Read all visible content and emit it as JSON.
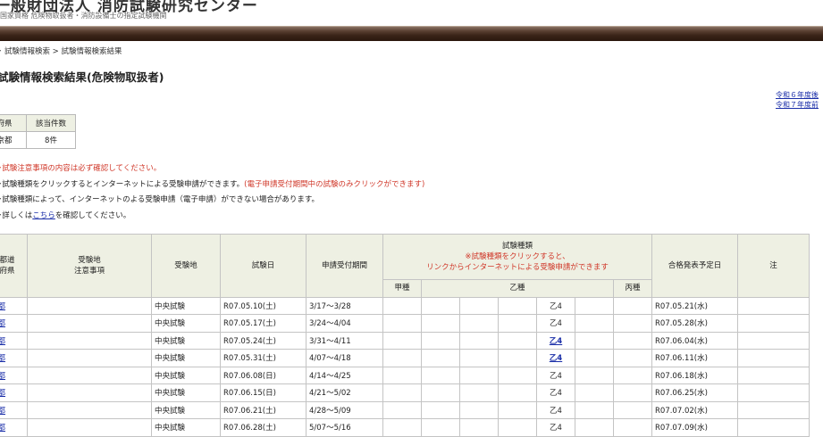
{
  "header": {
    "org_name": "一般財団法人 消防試験研究センター",
    "org_sub": "国家資格 危険物取扱者・消防設備士の指定試験機関"
  },
  "breadcrumb": [
    "試験情報検索",
    "試験情報検索結果"
  ],
  "page_title": "試験情報検索結果(危険物取扱者)",
  "year_links": [
    "令和６年度後",
    "令和７年度前"
  ],
  "summary": {
    "headers": [
      "府県",
      "該当件数"
    ],
    "values": [
      "京都",
      "8件"
    ]
  },
  "notes": {
    "line1": "試験注意事項の内容は必ず確認してください。",
    "line2_prefix": "試験種類をクリックするとインターネットによる受験申請ができます。",
    "line2_red": "(電子申請受付期間中の試験のみクリックができます)",
    "line3": "試験種類によって、インターネットのよる受験申請（電子申請）ができない場合があります。",
    "line4_prefix": "詳しくは",
    "line4_link": "こちら",
    "line4_suffix": "を確認してください。"
  },
  "table": {
    "headers": {
      "pref_line1": "都道",
      "pref_line2": "府県",
      "venue_notes_line1": "受験地",
      "venue_notes_line2": "注意事項",
      "venue": "受験地",
      "exam_date": "試験日",
      "application_period": "申請受付期間",
      "type": "試験種類",
      "type_note_line1": "※試験種類をクリックすると、",
      "type_note_line2": "リンクからインターネットによる受験申請ができます",
      "result_date": "合格発表予定日",
      "last_col": "注",
      "kou": "甲種",
      "otsu": "乙種",
      "hei": "丙種"
    },
    "rows": [
      {
        "pref": "京都",
        "venue": "中央試験",
        "exam_date": "R07.05.10(土)",
        "period": "3/17～3/28",
        "otsu": "乙4",
        "otsu_link": false,
        "result": "R07.05.21(水)"
      },
      {
        "pref": "京都",
        "venue": "中央試験",
        "exam_date": "R07.05.17(土)",
        "period": "3/24～4/04",
        "otsu": "乙4",
        "otsu_link": false,
        "result": "R07.05.28(水)"
      },
      {
        "pref": "京都",
        "venue": "中央試験",
        "exam_date": "R07.05.24(土)",
        "period": "3/31～4/11",
        "otsu": "乙4",
        "otsu_link": true,
        "result": "R07.06.04(水)"
      },
      {
        "pref": "京都",
        "venue": "中央試験",
        "exam_date": "R07.05.31(土)",
        "period": "4/07～4/18",
        "otsu": "乙4",
        "otsu_link": true,
        "result": "R07.06.11(水)"
      },
      {
        "pref": "京都",
        "venue": "中央試験",
        "exam_date": "R07.06.08(日)",
        "period": "4/14～4/25",
        "otsu": "乙4",
        "otsu_link": false,
        "result": "R07.06.18(水)"
      },
      {
        "pref": "京都",
        "venue": "中央試験",
        "exam_date": "R07.06.15(日)",
        "period": "4/21～5/02",
        "otsu": "乙4",
        "otsu_link": false,
        "result": "R07.06.25(水)"
      },
      {
        "pref": "京都",
        "venue": "中央試験",
        "exam_date": "R07.06.21(土)",
        "period": "4/28～5/09",
        "otsu": "乙4",
        "otsu_link": false,
        "result": "R07.07.02(水)"
      },
      {
        "pref": "京都",
        "venue": "中央試験",
        "exam_date": "R07.06.28(土)",
        "period": "5/07～5/16",
        "otsu": "乙4",
        "otsu_link": false,
        "result": "R07.07.09(水)"
      }
    ]
  },
  "colors": {
    "header_bar": "#3a2418",
    "table_header_bg": "#eef0e3",
    "link": "#1a2ea8",
    "notice_red": "#d0382a"
  }
}
